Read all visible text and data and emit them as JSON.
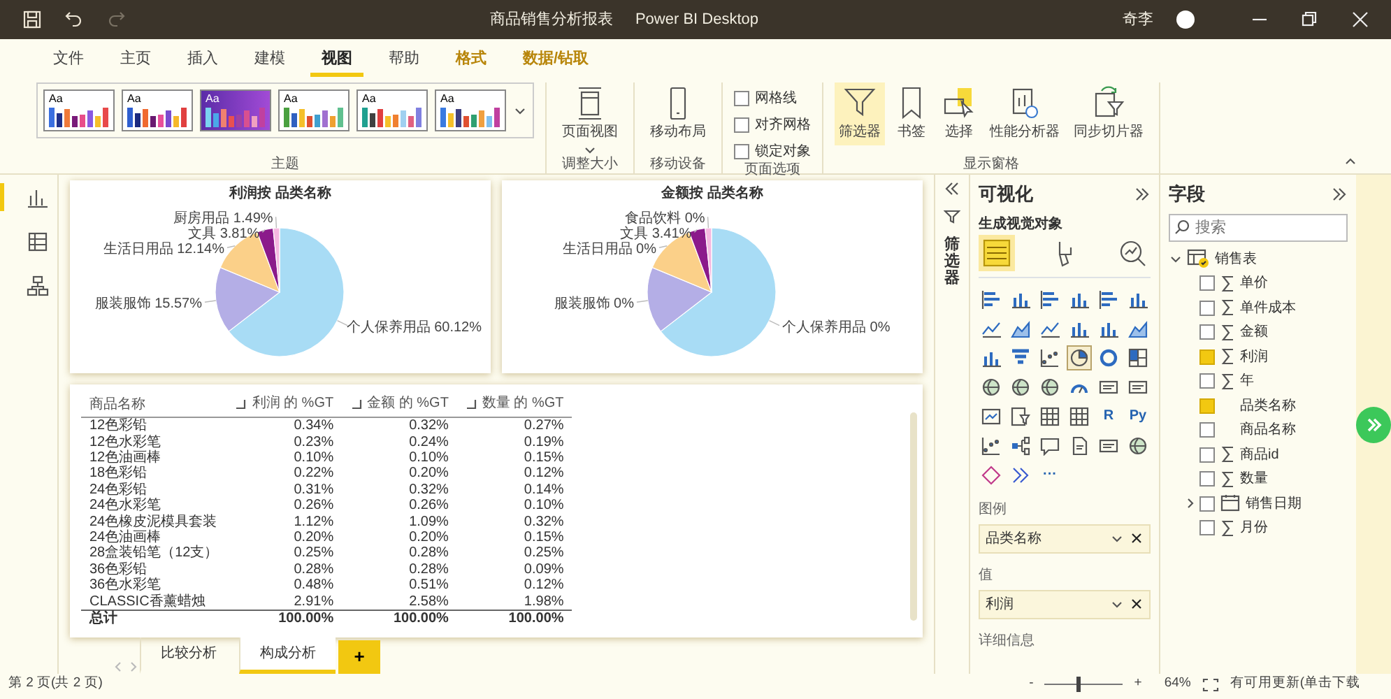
{
  "window": {
    "title": "商品销售分析报表",
    "app": "Power BI Desktop",
    "user": "奇李"
  },
  "quick_access": [
    {
      "kind": "save",
      "disabled": false
    },
    {
      "kind": "undo",
      "disabled": false
    },
    {
      "kind": "redo",
      "disabled": true
    }
  ],
  "menu_tabs": [
    {
      "label": "文件",
      "kind": "plain",
      "selected": false
    },
    {
      "label": "主页",
      "kind": "plain",
      "selected": false
    },
    {
      "label": "插入",
      "kind": "plain",
      "selected": false
    },
    {
      "label": "建模",
      "kind": "plain",
      "selected": false
    },
    {
      "label": "视图",
      "kind": "plain",
      "selected": true
    },
    {
      "label": "帮助",
      "kind": "plain",
      "selected": false
    },
    {
      "label": "格式",
      "kind": "context",
      "selected": false
    },
    {
      "label": "数据/钻取",
      "kind": "context",
      "selected": false
    }
  ],
  "ribbon": {
    "themes": {
      "label": "主题",
      "items": [
        {
          "sample": "Aa",
          "selected": false
        },
        {
          "sample": "Aa",
          "selected": false
        },
        {
          "sample": "Aa",
          "selected": true
        },
        {
          "sample": "Aa",
          "selected": false
        },
        {
          "sample": "Aa",
          "selected": false
        },
        {
          "sample": "Aa",
          "selected": false
        }
      ]
    },
    "resize": {
      "label": "调整大小",
      "button": "页面视图"
    },
    "mobile": {
      "label": "移动设备",
      "button": "移动布局"
    },
    "page_options": {
      "label": "页面选项",
      "options": [
        {
          "label": "网格线",
          "checked": false
        },
        {
          "label": "对齐网格",
          "checked": false
        },
        {
          "label": "锁定对象",
          "checked": false
        }
      ]
    },
    "panes": {
      "label": "显示窗格",
      "buttons": [
        {
          "label": "筛选器",
          "kind": "filter",
          "selected": true
        },
        {
          "label": "书签",
          "kind": "bookmark",
          "selected": false
        },
        {
          "label": "选择",
          "kind": "selection",
          "selected": false
        },
        {
          "label": "性能分析器",
          "kind": "performance",
          "selected": false
        },
        {
          "label": "同步切片器",
          "kind": "sync",
          "selected": false
        }
      ]
    }
  },
  "left_rail": [
    {
      "kind": "report",
      "selected": true
    },
    {
      "kind": "data",
      "selected": false
    },
    {
      "kind": "model",
      "selected": false
    }
  ],
  "visuals": [
    {
      "chart_data": {
        "type": "pie",
        "title": "利润按 品类名称",
        "categories": [
          "个人保养用品",
          "服装服饰",
          "生活日用品",
          "文具",
          "厨房用品"
        ],
        "values": [
          60.12,
          15.57,
          12.14,
          3.81,
          1.49
        ],
        "value_labels": [
          "60.12%",
          "15.57%",
          "12.14%",
          "3.81%",
          "1.49%"
        ]
      }
    },
    {
      "title": "金额按 品类名称",
      "slice_labels": [
        "食品饮料 0%",
        "文具 3.41%",
        "生活日用品 0%",
        "服装服饰 0%",
        "个人保养用品 0%"
      ]
    }
  ],
  "table": {
    "columns": [
      "商品名称",
      "利润 的 %GT",
      "金额 的 %GT",
      "数量 的 %GT"
    ],
    "rows": [
      [
        "12色彩铅",
        "0.34%",
        "0.32%",
        "0.27%"
      ],
      [
        "12色水彩笔",
        "0.23%",
        "0.24%",
        "0.19%"
      ],
      [
        "12色油画棒",
        "0.10%",
        "0.10%",
        "0.15%"
      ],
      [
        "18色彩铅",
        "0.22%",
        "0.20%",
        "0.12%"
      ],
      [
        "24色彩铅",
        "0.31%",
        "0.32%",
        "0.14%"
      ],
      [
        "24色水彩笔",
        "0.26%",
        "0.26%",
        "0.10%"
      ],
      [
        "24色橡皮泥模具套装",
        "1.12%",
        "1.09%",
        "0.32%"
      ],
      [
        "24色油画棒",
        "0.20%",
        "0.20%",
        "0.15%"
      ],
      [
        "28盒装铅笔（12支）",
        "0.25%",
        "0.28%",
        "0.25%"
      ],
      [
        "36色彩铅",
        "0.28%",
        "0.28%",
        "0.09%"
      ],
      [
        "36色水彩笔",
        "0.48%",
        "0.51%",
        "0.12%"
      ],
      [
        "CLASSIC香薰蜡烛",
        "2.91%",
        "2.58%",
        "1.98%"
      ]
    ],
    "total": [
      "总计",
      "100.00%",
      "100.00%",
      "100.00%"
    ]
  },
  "filters_pane": {
    "label": "筛选器"
  },
  "visualizations_pane": {
    "title": "可视化",
    "subtitle": "生成视觉对象",
    "tabs": [
      {
        "kind": "fields",
        "selected": true
      },
      {
        "kind": "format",
        "selected": false
      },
      {
        "kind": "analytics",
        "selected": false
      }
    ],
    "visual_types": [
      {
        "kind": "bar",
        "selected": false
      },
      {
        "kind": "column",
        "selected": false
      },
      {
        "kind": "bar",
        "selected": false
      },
      {
        "kind": "column",
        "selected": false
      },
      {
        "kind": "bar",
        "selected": false
      },
      {
        "kind": "column",
        "selected": false
      },
      {
        "kind": "line",
        "selected": false
      },
      {
        "kind": "area",
        "selected": false
      },
      {
        "kind": "line",
        "selected": false
      },
      {
        "kind": "column",
        "selected": false
      },
      {
        "kind": "column",
        "selected": false
      },
      {
        "kind": "area",
        "selected": false
      },
      {
        "kind": "column",
        "selected": false
      },
      {
        "kind": "funnel",
        "selected": false
      },
      {
        "kind": "scatter",
        "selected": false
      },
      {
        "kind": "pie",
        "selected": true
      },
      {
        "kind": "donut",
        "selected": false
      },
      {
        "kind": "treemap",
        "selected": false
      },
      {
        "kind": "map",
        "selected": false
      },
      {
        "kind": "map",
        "selected": false
      },
      {
        "kind": "map",
        "selected": false
      },
      {
        "kind": "gauge",
        "selected": false
      },
      {
        "kind": "card",
        "selected": false
      },
      {
        "kind": "card",
        "selected": false
      },
      {
        "kind": "kpi",
        "selected": false
      },
      {
        "kind": "slicer",
        "selected": false
      },
      {
        "kind": "table",
        "selected": false
      },
      {
        "kind": "table",
        "selected": false
      },
      {
        "kind": "script",
        "text": "R",
        "selected": false
      },
      {
        "kind": "script",
        "text": "Py",
        "selected": false
      },
      {
        "kind": "scatter",
        "selected": false
      },
      {
        "kind": "decomp",
        "selected": false
      },
      {
        "kind": "qa",
        "selected": false
      },
      {
        "kind": "text",
        "selected": false
      },
      {
        "kind": "card",
        "selected": false
      },
      {
        "kind": "map",
        "selected": false
      },
      {
        "kind": "apps",
        "selected": false
      },
      {
        "kind": "flow",
        "selected": false
      },
      {
        "kind": "more",
        "text": "···",
        "selected": false
      }
    ],
    "wells": [
      {
        "label": "图例",
        "field": "品类名称"
      },
      {
        "label": "值",
        "field": "利润"
      },
      {
        "label": "详细信息"
      }
    ]
  },
  "fields_pane": {
    "title": "字段",
    "placeholder": "搜索",
    "tables": [
      {
        "name": "销售表",
        "expanded": true,
        "checked": true,
        "fields": [
          {
            "name": "单价",
            "kind": "measure",
            "checked": false
          },
          {
            "name": "单件成本",
            "kind": "measure",
            "checked": false
          },
          {
            "name": "金额",
            "kind": "measure",
            "checked": false
          },
          {
            "name": "利润",
            "kind": "measure",
            "checked": true
          },
          {
            "name": "年",
            "kind": "measure",
            "checked": false
          },
          {
            "name": "品类名称",
            "kind": "plain",
            "checked": true
          },
          {
            "name": "商品名称",
            "kind": "plain",
            "checked": false
          },
          {
            "name": "商品id",
            "kind": "measure",
            "checked": false
          },
          {
            "name": "数量",
            "kind": "measure",
            "checked": false
          },
          {
            "name": "销售日期",
            "kind": "date",
            "checked": false,
            "expanded": false
          },
          {
            "name": "月份",
            "kind": "measure",
            "checked": false
          }
        ]
      }
    ]
  },
  "page_tabs": [
    {
      "label": "比较分析",
      "selected": false
    },
    {
      "label": "构成分析",
      "selected": true
    }
  ],
  "add_page": "+",
  "status_bar": {
    "page": "第 2 页(共 2 页)",
    "zoom_minus": "-",
    "zoom_plus": "+",
    "zoom_slider": {
      "level": 0.4
    },
    "zoom": "64%",
    "update": "有可用更新(单击下载"
  }
}
